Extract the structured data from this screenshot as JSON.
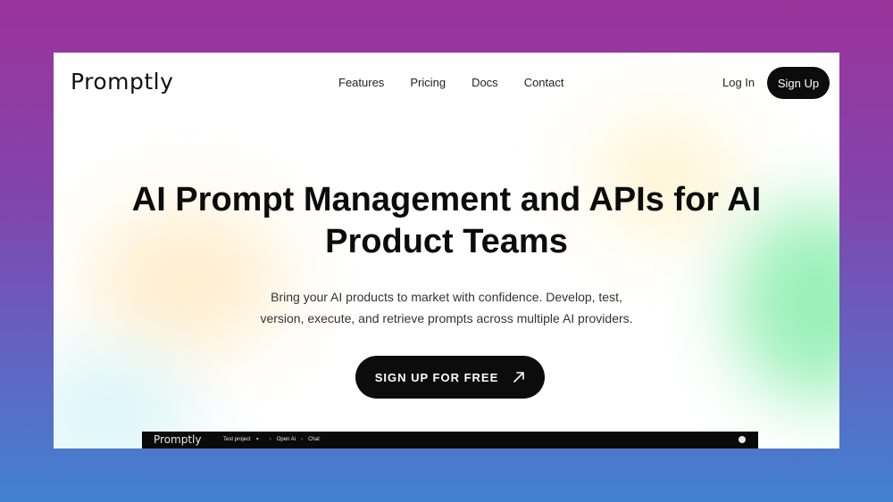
{
  "brand": {
    "logo": "Promptly"
  },
  "nav": {
    "links": [
      "Features",
      "Pricing",
      "Docs",
      "Contact"
    ],
    "login_label": "Log In",
    "signup_label": "Sign Up"
  },
  "hero": {
    "title_line1": "AI Prompt Management and APIs for AI",
    "title_line2": "Product Teams",
    "subtitle_line1": "Bring your AI products to market with confidence. Develop, test,",
    "subtitle_line2": "version, execute, and retrieve prompts across multiple AI providers.",
    "cta_label": "SIGN UP FOR FREE",
    "cta_icon": "arrow-up-right-icon"
  },
  "app_preview": {
    "logo": "Promptly",
    "breadcrumbs": [
      "Test project",
      "Open Ai",
      "Chat"
    ],
    "avatar_icon": "user-avatar-icon"
  },
  "colors": {
    "background_top": "#9b339a",
    "background_bottom": "#4182d1",
    "button_dark": "#0c0c0c",
    "text_primary": "#0c0c0c"
  }
}
